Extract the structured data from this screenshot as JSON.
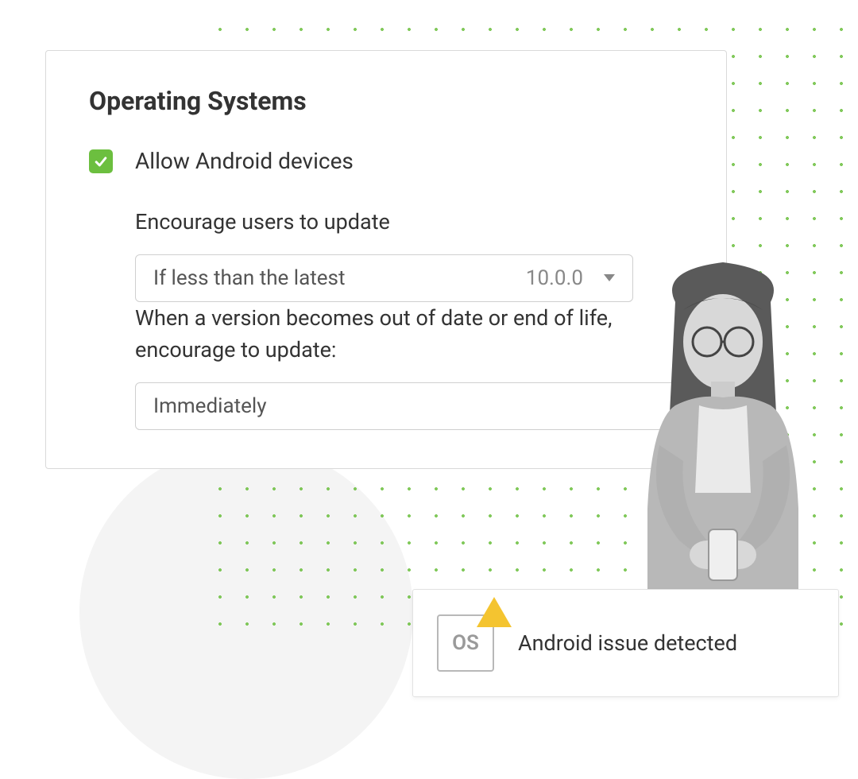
{
  "settings": {
    "title": "Operating Systems",
    "allow_android": {
      "checked": true,
      "label": "Allow Android devices"
    },
    "encourage_update": {
      "label": "Encourage users to update",
      "condition": "If less than the latest",
      "version": "10.0.0"
    },
    "out_of_date": {
      "label": "When a version becomes out of date or end of life, encourage to update:",
      "value": "Immediately"
    }
  },
  "alert": {
    "badge_text": "OS",
    "message": "Android issue detected"
  },
  "colors": {
    "accent_green": "#6cbf3f",
    "warning_yellow": "#f4c430"
  }
}
